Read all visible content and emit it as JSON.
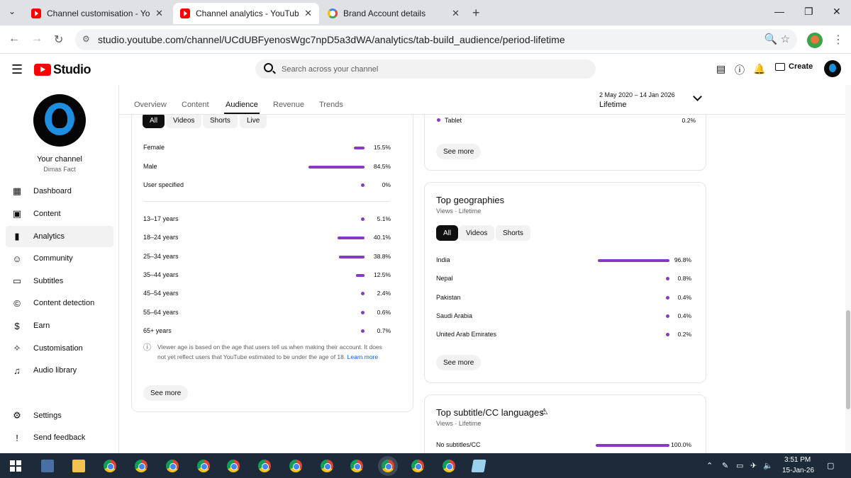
{
  "browser": {
    "tabs": [
      {
        "label": "Channel customisation - YouTube Studio",
        "icon": "youtube-icon",
        "active": false
      },
      {
        "label": "Channel analytics - YouTube Studio",
        "icon": "youtube-icon",
        "active": true
      },
      {
        "label": "Brand Account details",
        "icon": "google-icon",
        "active": false
      }
    ],
    "url": "studio.youtube.com/channel/UCdUBFyenosWgc7npD5a3dWA/analytics/tab-build_audience/period-lifetime"
  },
  "header": {
    "logo_text": "Studio",
    "search_placeholder": "Search across your channel",
    "create_label": "Create"
  },
  "sidebar": {
    "channel_title": "Your channel",
    "channel_name": "Dimas Fact",
    "items": [
      {
        "label": "Dashboard",
        "icon": "dashboard-icon"
      },
      {
        "label": "Content",
        "icon": "content-icon"
      },
      {
        "label": "Analytics",
        "icon": "analytics-icon",
        "active": true
      },
      {
        "label": "Community",
        "icon": "community-icon"
      },
      {
        "label": "Subtitles",
        "icon": "subtitles-icon"
      },
      {
        "label": "Content detection",
        "icon": "copyright-icon"
      },
      {
        "label": "Earn",
        "icon": "dollar-icon"
      },
      {
        "label": "Customisation",
        "icon": "magic-wand-icon"
      },
      {
        "label": "Audio library",
        "icon": "audio-library-icon"
      }
    ],
    "bottom_items": [
      {
        "label": "Settings",
        "icon": "gear-icon"
      },
      {
        "label": "Send feedback",
        "icon": "feedback-icon"
      }
    ]
  },
  "analytics_tabs": [
    "Overview",
    "Content",
    "Audience",
    "Revenue",
    "Trends"
  ],
  "period": {
    "date_range": "2 May 2020 – 14 Jan 2026",
    "label": "Lifetime"
  },
  "demographics": {
    "filters": [
      "All",
      "Videos",
      "Shorts",
      "Live"
    ],
    "gender": [
      {
        "label": "Female",
        "value": "15.5%",
        "fraction": 0.155
      },
      {
        "label": "Male",
        "value": "84.5%",
        "fraction": 0.845
      },
      {
        "label": "User specified",
        "value": "0%",
        "fraction": 0
      }
    ],
    "age": [
      {
        "label": "13–17 years",
        "value": "5.1%",
        "fraction": 0.051
      },
      {
        "label": "18–24 years",
        "value": "40.1%",
        "fraction": 0.401
      },
      {
        "label": "25–34 years",
        "value": "38.8%",
        "fraction": 0.388
      },
      {
        "label": "35–44 years",
        "value": "12.5%",
        "fraction": 0.125
      },
      {
        "label": "45–54 years",
        "value": "2.4%",
        "fraction": 0.024
      },
      {
        "label": "55–64 years",
        "value": "0.6%",
        "fraction": 0.006
      },
      {
        "label": "65+ years",
        "value": "0.7%",
        "fraction": 0.007
      }
    ],
    "note_line1": "Viewer age is based on the age that users tell us when making their account. It does",
    "note_line2": "not yet reflect users that YouTube estimated to be under the age of 18.",
    "learn_more": "Learn more",
    "see_more": "See more"
  },
  "devices": {
    "rows": [
      {
        "label": "Tablet",
        "value": "0.2%"
      }
    ],
    "see_more": "See more"
  },
  "geographies": {
    "title": "Top geographies",
    "subtitle": "Views · Lifetime",
    "filters": [
      "All",
      "Videos",
      "Shorts"
    ],
    "rows": [
      {
        "label": "India",
        "value": "96.8%",
        "fraction": 0.968
      },
      {
        "label": "Nepal",
        "value": "0.8%",
        "fraction": 0.008
      },
      {
        "label": "Pakistan",
        "value": "0.4%",
        "fraction": 0.004
      },
      {
        "label": "Saudi Arabia",
        "value": "0.4%",
        "fraction": 0.004
      },
      {
        "label": "United Arab Emirates",
        "value": "0.2%",
        "fraction": 0.002
      }
    ],
    "see_more": "See more"
  },
  "subtitles_card": {
    "title": "Top subtitle/CC languages",
    "subtitle": "Views · Lifetime",
    "rows": [
      {
        "label": "No subtitles/CC",
        "value": "100.0%",
        "fraction": 1.0
      }
    ]
  },
  "taskbar": {
    "time": "3:51 PM",
    "date": "15-Jan-26"
  },
  "colors": {
    "accent": "#8a3ac2",
    "youtube_red": "#ff0000"
  }
}
